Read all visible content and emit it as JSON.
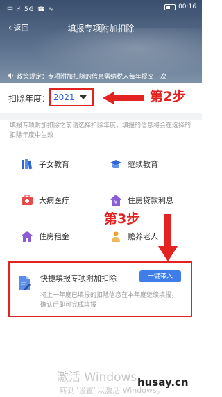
{
  "status_bar": {
    "left": "中 ⚡ 5G ☎ ≋",
    "right": "00:16"
  },
  "nav": {
    "back_label": "返回",
    "title": "填报专项附加扣除"
  },
  "notice": {
    "text": "政策规定：专项附加扣除的信息需纳税人每年提交一次"
  },
  "year": {
    "label": "扣除年度：",
    "value": "2021"
  },
  "annotations": {
    "step2": "第2步",
    "step3": "第3步",
    "accent_color": "#e32222"
  },
  "hint": "填报专项附加扣除之前请选择扣除年度，填报的信息将会在选择的扣除年度中生效",
  "categories": [
    {
      "label": "子女教育",
      "icon": "books-icon",
      "color": "#2e66d9"
    },
    {
      "label": "继续教育",
      "icon": "graduation-cap-icon",
      "color": "#2e66d9"
    },
    {
      "label": "大病医疗",
      "icon": "medical-kit-icon",
      "color": "#e84a4a"
    },
    {
      "label": "住房贷款利息",
      "icon": "house-icon",
      "color": "#8a5cd6"
    },
    {
      "label": "住房租金",
      "icon": "house-rent-icon",
      "color": "#8a5cd6"
    },
    {
      "label": "赡养老人",
      "icon": "elder-icon",
      "color": "#e8a23a"
    }
  ],
  "quick_fill": {
    "title": "快捷填报专项附加扣除",
    "button": "一键带入",
    "desc": "将上一年度已填报的扣除信息在本年度继续填报，确认后即可完成填报",
    "button_color": "#3f7ee8"
  },
  "watermark": {
    "line1": "激活 Windows",
    "line2": "转到\"设置\"以激活 Windows。",
    "site": "husay.cn"
  }
}
